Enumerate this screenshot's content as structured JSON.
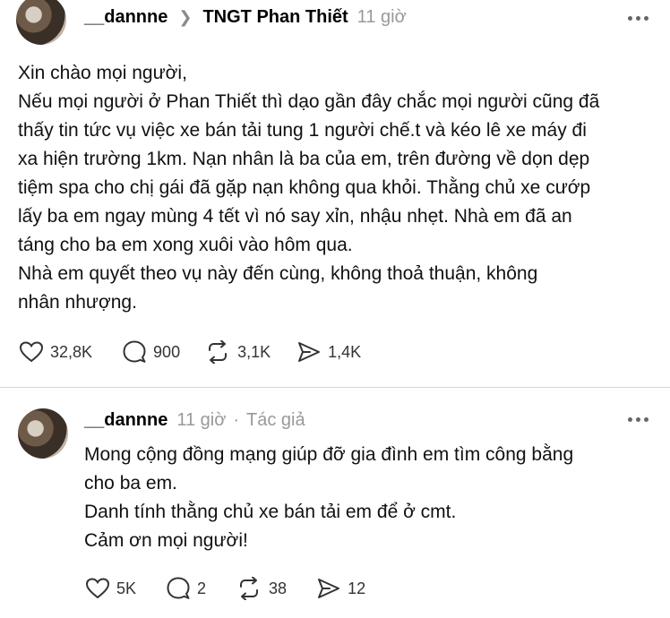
{
  "post": {
    "username": "__dannne",
    "community": "TNGT Phan Thiết",
    "time": "11 giờ",
    "paragraphs": [
      "Xin chào mọi người,",
      "Nếu mọi người ở Phan Thiết thì dạo gần đây chắc mọi người cũng đã",
      "thấy tin tức vụ việc xe bán tải tung 1 người chế.t và kéo lê xe máy đi",
      "xa hiện trường 1km. Nạn nhân là ba của em, trên đường về dọn dẹp",
      "tiệm spa cho chị gái đã gặp nạn không qua khỏi. Thằng chủ xe cướp",
      "lấy ba em ngay mùng 4 tết vì nó say xỉn, nhậu nhẹt. Nhà em đã an",
      "táng cho ba em xong xuôi vào hôm qua.",
      "Nhà em quyết theo vụ này đến cùng, không thoả thuận, không",
      "nhân nhượng."
    ],
    "likes": "32,8K",
    "replies": "900",
    "reposts": "3,1K",
    "shares": "1,4K"
  },
  "reply": {
    "username": "__dannne",
    "time": "11 giờ",
    "dot": "·",
    "author_badge": "Tác giả",
    "paragraphs": [
      "Mong cộng đồng mạng giúp đỡ gia đình em tìm công bằng",
      "cho ba em.",
      "Danh tính thằng chủ xe bán tải em để ở cmt.",
      "Cảm ơn mọi người!"
    ],
    "likes": "5K",
    "replies": "2",
    "reposts": "38",
    "shares": "12"
  },
  "icons": {
    "separator": "chevron-right-icon",
    "more": "more-icon",
    "like": "heart-icon",
    "reply": "comment-icon",
    "repost": "repost-icon",
    "share": "send-icon"
  }
}
